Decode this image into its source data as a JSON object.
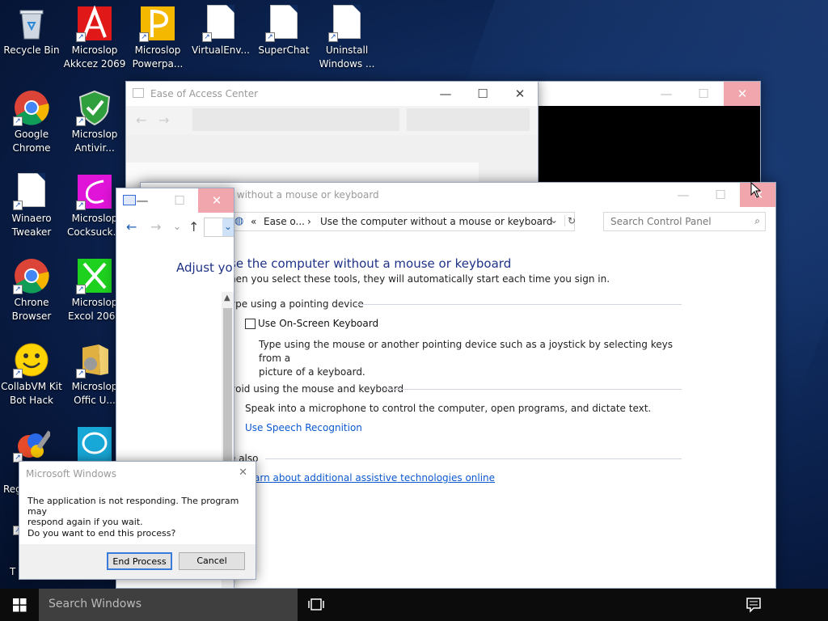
{
  "desktop_icons": [
    {
      "label": "Recycle Bin",
      "icon": "recycle-bin-icon"
    },
    {
      "label": "Microslop\nAkkcez 2069",
      "icon": "access-icon"
    },
    {
      "label": "Microslop\nPowerpa...",
      "icon": "powerpoint-icon"
    },
    {
      "label": "VirtualEnv...",
      "icon": "document-icon"
    },
    {
      "label": "SuperChat",
      "icon": "document-icon"
    },
    {
      "label": "Uninstall\nWindows ...",
      "icon": "document-icon"
    },
    {
      "label": "Google\nChrome",
      "icon": "chrome-icon"
    },
    {
      "label": "Microslop\nAntivir...",
      "icon": "shield-icon"
    },
    {
      "label": "Winaero\nTweaker",
      "icon": "document-icon"
    },
    {
      "label": "Microslop\nCocksuck...",
      "icon": "pink-icon"
    },
    {
      "label": "Chrone\nBrowser",
      "icon": "chrome-icon"
    },
    {
      "label": "Microslop\nExcol 2069",
      "icon": "excel-icon"
    },
    {
      "label": "CollabVM Kit\nBot Hack",
      "icon": "smiley-icon"
    },
    {
      "label": "Microslop\nOffic U...",
      "icon": "office-folder-icon"
    },
    {
      "label": "Reg",
      "icon": "registry-icon"
    },
    {
      "label": "",
      "icon": "chat-ring-icon"
    },
    {
      "label": "T",
      "icon": "partial-icon"
    }
  ],
  "ease_window": {
    "title": "Ease of Access Center"
  },
  "main_window": {
    "title_partial": "r without a mouse or keyboard",
    "breadcrumb": {
      "sep0": "«",
      "root": "Ease o...",
      "sep1": "›",
      "current": "Use the computer without a mouse or keyboard"
    },
    "search_placeholder": "Search Control Panel",
    "heading": "se the computer without a mouse or keyboard",
    "intro": "hen you select these tools, they will automatically start each time you sign in.",
    "section1": "ype using a pointing device",
    "osk_label": "Use On-Screen Keyboard",
    "osk_desc": "Type using the mouse or another pointing device such as a joystick by selecting keys from a\npicture of a keyboard.",
    "section2": "void using the mouse and keyboard",
    "speech_desc": "Speak into a microphone to control the computer, open programs, and dictate text.",
    "speech_link": "Use Speech Recognition",
    "section3": "e also",
    "learn_link": "arn about additional assistive technologies online"
  },
  "small_window": {
    "heading": "Adjust yo"
  },
  "dialog": {
    "title": "Microsoft Windows",
    "message": "The application is not responding. The program may\nrespond again if you wait.",
    "question": "Do you want to end this process?",
    "end_label": "End Process",
    "cancel_label": "Cancel"
  },
  "taskbar": {
    "search_placeholder": "Search Windows"
  }
}
